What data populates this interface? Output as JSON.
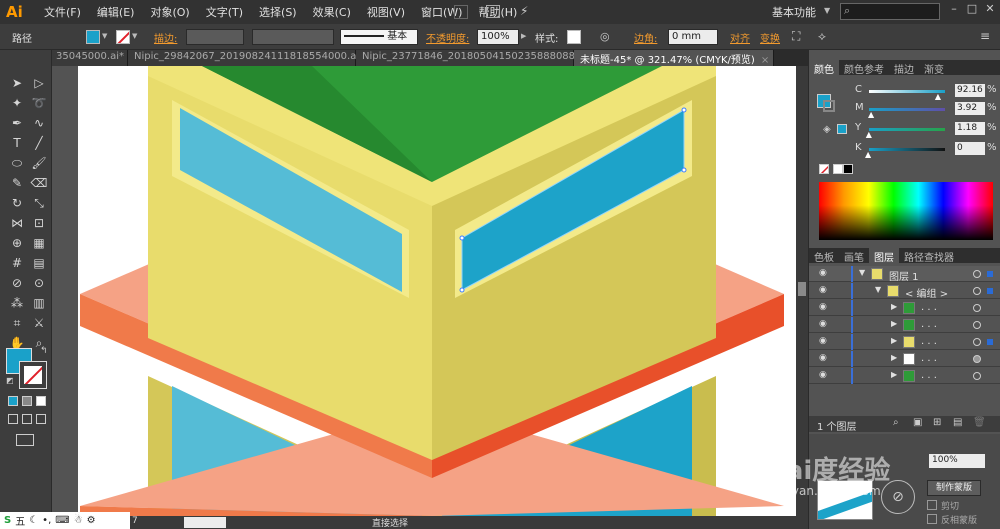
{
  "app": {
    "logo": "Ai",
    "menus": [
      "文件(F)",
      "编辑(E)",
      "对象(O)",
      "文字(T)",
      "选择(S)",
      "效果(C)",
      "视图(V)",
      "窗口(W)",
      "帮助(H)"
    ],
    "workspace": "基本功能",
    "search_icon": "search-icon"
  },
  "control_bar": {
    "selection_label": "路径",
    "fill_color": "#1aa1c9",
    "stroke_label": "描边:",
    "stroke_profile": "基本",
    "opacity_label": "不透明度:",
    "opacity_value": "100%",
    "style_label": "样式:",
    "corner_label": "边角:",
    "corner_value": "0 mm",
    "align_label": "对齐",
    "transform_label": "变换"
  },
  "tabs": [
    {
      "label": "35045000.ai*",
      "active": false
    },
    {
      "label": "Nipic_29842067_20190824111818554000.ai*",
      "active": false
    },
    {
      "label": "Nipic_23771846_20180504150235888088.ai*",
      "active": false
    },
    {
      "label": "未标题-45* @ 321.47% (CMYK/预览)",
      "active": true
    }
  ],
  "color_panel": {
    "tabs": [
      "颜色",
      "颜色参考",
      "描边",
      "渐变"
    ],
    "active_tab": "颜色",
    "channels": [
      {
        "label": "C",
        "value": "92.16",
        "color": "#19a0c8",
        "level": 0.92
      },
      {
        "label": "M",
        "value": "3.92",
        "color": "#c23f8a",
        "level": 0.04
      },
      {
        "label": "Y",
        "value": "1.18",
        "color": "#27a34a",
        "level": 0.01
      },
      {
        "label": "K",
        "value": "0",
        "color": "#222222",
        "level": 0.0
      }
    ],
    "percent_sign": "%"
  },
  "layers_panel": {
    "tabs": [
      "色板",
      "画笔",
      "图层",
      "路径查找器"
    ],
    "active_tab": "图层",
    "layer_name": "图层 1",
    "group_name": "< 编组 >",
    "sublayer_label": ". . .",
    "footer": "1 个图层"
  },
  "transparency_panel": {
    "opacity_value": "100%",
    "make_mask_button": "制作蒙版",
    "clip_label": "剪切",
    "invert_label": "反相蒙版"
  },
  "status": {
    "tool_name": "直接选择",
    "zoom": "7"
  },
  "taskbar": {
    "ime_label": "五"
  },
  "watermark": {
    "brand": "Bai度经验",
    "url": "jingyan.baidu.com"
  },
  "colors": {
    "ui_dark": "#323232",
    "ui_mid": "#535353",
    "accent_orange": "#f29a2e",
    "building_yellow": "#e8dc6c",
    "building_shade": "#d4c758",
    "window_blue": "#55bcd6",
    "window_blue_dark": "#1da3c9",
    "roof_green": "#2e9b38",
    "ledge_salmon": "#f5a285",
    "ledge_orange": "#f07a4a",
    "ledge_red": "#e8502a"
  }
}
